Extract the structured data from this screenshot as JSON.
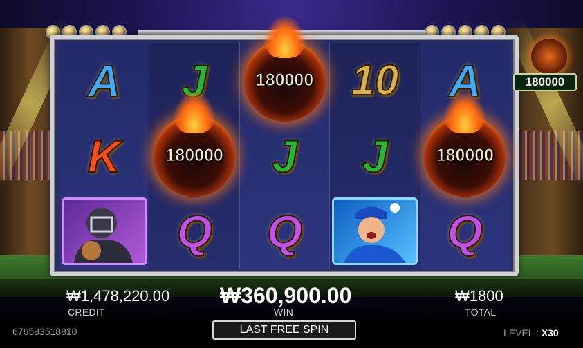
{
  "reels": [
    [
      {
        "symbol": "A"
      },
      {
        "symbol": "K"
      },
      {
        "symbol": "catcher"
      }
    ],
    [
      {
        "symbol": "J"
      },
      {
        "symbol": "fireball",
        "value": "180000"
      },
      {
        "symbol": "Q"
      }
    ],
    [
      {
        "symbol": "fireball",
        "value": "180000"
      },
      {
        "symbol": "J"
      },
      {
        "symbol": "Q"
      }
    ],
    [
      {
        "symbol": "10"
      },
      {
        "symbol": "J"
      },
      {
        "symbol": "pitcher"
      }
    ],
    [
      {
        "symbol": "A"
      },
      {
        "symbol": "fireball",
        "value": "180000"
      },
      {
        "symbol": "Q"
      }
    ]
  ],
  "side_prize": {
    "value": "180000"
  },
  "status": {
    "credit": {
      "amount": "₩1,478,220.00",
      "label": "CREDIT"
    },
    "win": {
      "amount": "₩360,900.00",
      "label": "WIN"
    },
    "total": {
      "amount": "₩1800",
      "label": "TOTAL"
    }
  },
  "footer": {
    "serial": "676593518810",
    "spin_label": "LAST FREE SPIN",
    "level_label": "LEVEL : ",
    "level_value": "X30"
  },
  "colors": {
    "accent": "#ff8a1a",
    "reel_bg": "#232a6a",
    "fire_text": "#f4ecd8"
  }
}
